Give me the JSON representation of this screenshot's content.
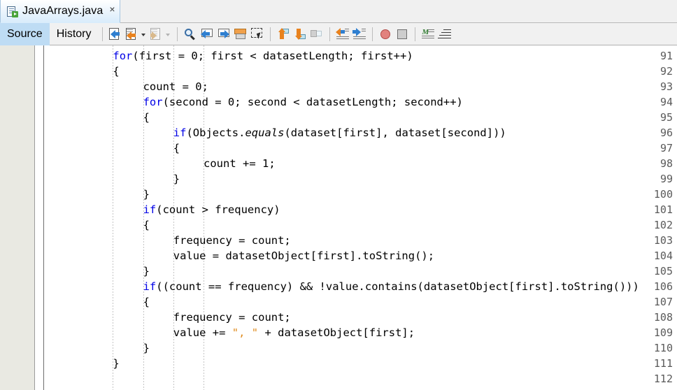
{
  "window": {
    "tab": {
      "title": "JavaArrays.java",
      "icon": "java-class-file-icon",
      "close_label": "×"
    }
  },
  "toolbar": {
    "views": [
      {
        "label": "Source",
        "active": true
      },
      {
        "label": "History",
        "active": false
      }
    ],
    "buttons": [
      {
        "name": "toggle-bookmark-icon",
        "kind": "doc-arrow-left",
        "enabled": true
      },
      {
        "name": "previous-bookmark-icon",
        "kind": "doc-arrow-left-2",
        "enabled": true
      },
      {
        "name": "bookmark-dropdown-icon",
        "kind": "dropdown",
        "enabled": true
      },
      {
        "name": "next-bookmark-icon",
        "kind": "doc-arrow-right",
        "enabled": false
      },
      {
        "name": "next-bookmark-dropdown-icon",
        "kind": "dropdown",
        "enabled": false
      },
      {
        "name": "find-selection-icon",
        "kind": "magnifier",
        "enabled": true
      },
      {
        "name": "find-previous-icon",
        "kind": "box-arrow-left",
        "enabled": true
      },
      {
        "name": "find-next-icon",
        "kind": "box-arrow-right",
        "enabled": true
      },
      {
        "name": "toggle-highlight-icon",
        "kind": "box-highlight",
        "enabled": true
      },
      {
        "name": "toggle-rectangular-selection-icon",
        "kind": "marquee",
        "enabled": true
      },
      {
        "name": "previous-error-icon",
        "kind": "tag-arrow-up",
        "enabled": true
      },
      {
        "name": "next-error-icon",
        "kind": "tag-arrow-down",
        "enabled": true
      },
      {
        "name": "last-edit-icon",
        "kind": "tag-arrow-back",
        "enabled": false
      },
      {
        "name": "shift-line-left-icon",
        "kind": "lines-arrow-left",
        "enabled": true
      },
      {
        "name": "shift-line-right-icon",
        "kind": "lines-arrow-right",
        "enabled": true
      },
      {
        "name": "toggle-breakpoint-icon",
        "kind": "red-circle",
        "enabled": true
      },
      {
        "name": "stop-icon",
        "kind": "grey-square",
        "enabled": true
      },
      {
        "name": "toggle-comment-icon",
        "kind": "comment-lines",
        "enabled": true
      },
      {
        "name": "format-icon",
        "kind": "format-lines",
        "enabled": true
      }
    ]
  },
  "editor": {
    "first_line": 91,
    "last_line": 112,
    "line_numbers": [
      91,
      92,
      93,
      94,
      95,
      96,
      97,
      98,
      99,
      100,
      101,
      102,
      103,
      104,
      105,
      106,
      107,
      108,
      109,
      110,
      111,
      112
    ],
    "colors": {
      "keyword": "#0000e6",
      "string": "#e08b1e",
      "text": "#000000",
      "gutter_bg": "#e9e9e2",
      "gutter_fg": "#5a5a5a",
      "editor_bg": "#ffffff",
      "tab_accent": "#bedcf4"
    },
    "lines": [
      {
        "n": 91,
        "indent": 8,
        "tokens": [
          {
            "t": "for",
            "c": "kw"
          },
          {
            "t": "(first = 0; first < datasetLength; first++)",
            "c": ""
          }
        ]
      },
      {
        "n": 92,
        "indent": 8,
        "tokens": [
          {
            "t": "{",
            "c": ""
          }
        ]
      },
      {
        "n": 93,
        "indent": 12,
        "tokens": [
          {
            "t": "count = 0;",
            "c": ""
          }
        ]
      },
      {
        "n": 94,
        "indent": 12,
        "tokens": [
          {
            "t": "for",
            "c": "kw"
          },
          {
            "t": "(second = 0; second < datasetLength; second++)",
            "c": ""
          }
        ]
      },
      {
        "n": 95,
        "indent": 12,
        "tokens": [
          {
            "t": "{",
            "c": ""
          }
        ]
      },
      {
        "n": 96,
        "indent": 16,
        "tokens": [
          {
            "t": "if",
            "c": "kw"
          },
          {
            "t": "(Objects.",
            "c": ""
          },
          {
            "t": "equals",
            "c": "stat"
          },
          {
            "t": "(dataset[first], dataset[second]))",
            "c": ""
          }
        ]
      },
      {
        "n": 97,
        "indent": 16,
        "tokens": [
          {
            "t": "{",
            "c": ""
          }
        ]
      },
      {
        "n": 98,
        "indent": 20,
        "tokens": [
          {
            "t": "count += 1;",
            "c": ""
          }
        ]
      },
      {
        "n": 99,
        "indent": 16,
        "tokens": [
          {
            "t": "}",
            "c": ""
          }
        ]
      },
      {
        "n": 100,
        "indent": 12,
        "tokens": [
          {
            "t": "}",
            "c": ""
          }
        ]
      },
      {
        "n": 101,
        "indent": 12,
        "tokens": [
          {
            "t": "if",
            "c": "kw"
          },
          {
            "t": "(count > frequency)",
            "c": ""
          }
        ]
      },
      {
        "n": 102,
        "indent": 12,
        "tokens": [
          {
            "t": "{",
            "c": ""
          }
        ]
      },
      {
        "n": 103,
        "indent": 16,
        "tokens": [
          {
            "t": "frequency = count;",
            "c": ""
          }
        ]
      },
      {
        "n": 104,
        "indent": 16,
        "tokens": [
          {
            "t": "value = datasetObject[first].toString();",
            "c": ""
          }
        ]
      },
      {
        "n": 105,
        "indent": 12,
        "tokens": [
          {
            "t": "}",
            "c": ""
          }
        ]
      },
      {
        "n": 106,
        "indent": 12,
        "tokens": [
          {
            "t": "if",
            "c": "kw"
          },
          {
            "t": "((count == frequency) && !value.contains(datasetObject[first].toString()))",
            "c": ""
          }
        ]
      },
      {
        "n": 107,
        "indent": 12,
        "tokens": [
          {
            "t": "{",
            "c": ""
          }
        ]
      },
      {
        "n": 108,
        "indent": 16,
        "tokens": [
          {
            "t": "frequency = count;",
            "c": ""
          }
        ]
      },
      {
        "n": 109,
        "indent": 16,
        "tokens": [
          {
            "t": "value += ",
            "c": ""
          },
          {
            "t": "\", \"",
            "c": "str"
          },
          {
            "t": " + datasetObject[first];",
            "c": ""
          }
        ]
      },
      {
        "n": 110,
        "indent": 12,
        "tokens": [
          {
            "t": "}",
            "c": ""
          }
        ]
      },
      {
        "n": 111,
        "indent": 8,
        "tokens": [
          {
            "t": "}",
            "c": ""
          }
        ]
      },
      {
        "n": 112,
        "indent": 0,
        "tokens": []
      }
    ],
    "indent_guide_columns": [
      8,
      12,
      16,
      20
    ]
  }
}
